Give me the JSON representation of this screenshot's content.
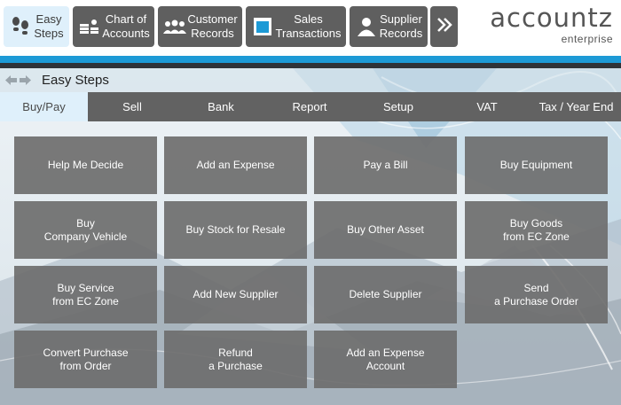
{
  "toolbar": {
    "buttons": [
      {
        "line1": "Easy",
        "line2": "Steps",
        "icon": "footprints-icon",
        "active": true
      },
      {
        "line1": "Chart of",
        "line2": "Accounts",
        "icon": "ledger-stack-icon",
        "active": false
      },
      {
        "line1": "Customer",
        "line2": "Records",
        "icon": "people-group-icon",
        "active": false
      },
      {
        "line1": "Sales",
        "line2": "Transactions",
        "icon": "sales-window-icon",
        "active": false
      },
      {
        "line1": "Supplier",
        "line2": "Records",
        "icon": "person-icon",
        "active": false
      }
    ],
    "more_icon": "double-chevron-right-icon"
  },
  "brand": {
    "name": "accountz",
    "subtitle": "enterprise"
  },
  "breadcrumb": {
    "title": "Easy Steps"
  },
  "tabs": [
    {
      "label": "Buy/Pay",
      "active": true
    },
    {
      "label": "Sell"
    },
    {
      "label": "Bank"
    },
    {
      "label": "Report"
    },
    {
      "label": "Setup"
    },
    {
      "label": "VAT"
    },
    {
      "label": "Tax / Year End"
    }
  ],
  "tiles": [
    [
      "Help Me Decide",
      ""
    ],
    [
      "Add an Expense",
      ""
    ],
    [
      "Pay a Bill",
      ""
    ],
    [
      "Buy Equipment",
      ""
    ],
    [
      "Buy",
      "Company Vehicle"
    ],
    [
      "Buy Stock for Resale",
      ""
    ],
    [
      "Buy Other Asset",
      ""
    ],
    [
      "Buy Goods",
      "from EC Zone"
    ],
    [
      "Buy Service",
      "from EC Zone"
    ],
    [
      "Add New Supplier",
      ""
    ],
    [
      "Delete Supplier",
      ""
    ],
    [
      "Send",
      "a Purchase Order"
    ],
    [
      "Convert Purchase",
      "from Order"
    ],
    [
      "Refund",
      "a Purchase"
    ],
    [
      "Add an Expense",
      "Account"
    ]
  ],
  "colors": {
    "accent": "#1d9ad6",
    "tile": "#6e6e6e",
    "active_tab": "#dff0fb",
    "bar": "#626262"
  }
}
